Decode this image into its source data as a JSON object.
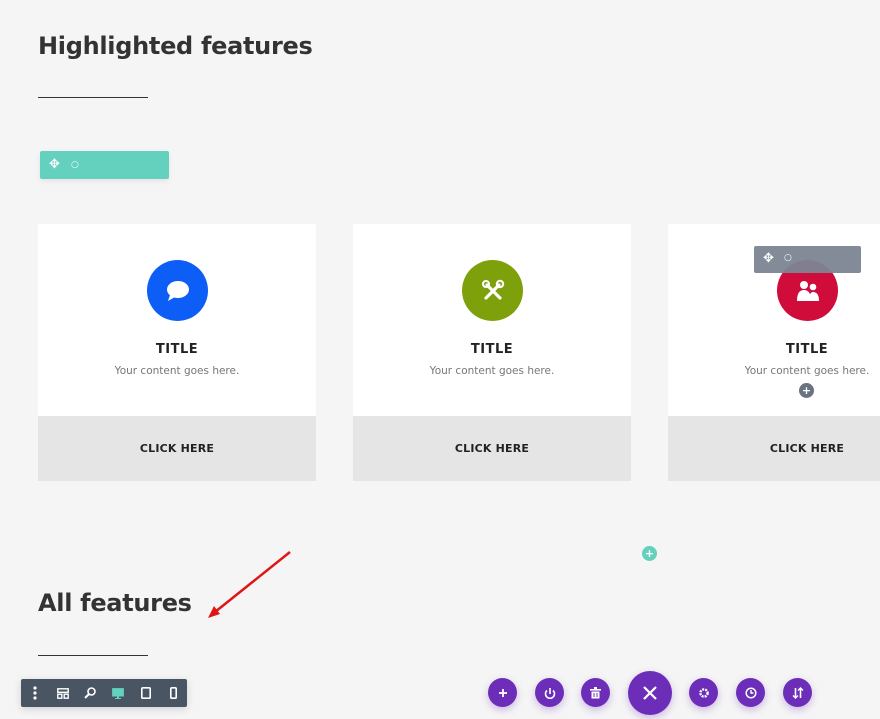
{
  "sections": {
    "highlighted": {
      "heading": "Highlighted features"
    },
    "all": {
      "heading": "All features"
    }
  },
  "cards": [
    {
      "icon": "chat-bubble-icon",
      "color": "#0c5ef6",
      "title": "TITLE",
      "text": "Your content goes here.",
      "button": "CLICK HERE"
    },
    {
      "icon": "tools-icon",
      "color": "#7ea00a",
      "title": "TITLE",
      "text": "Your content goes here.",
      "button": "CLICK HERE"
    },
    {
      "icon": "users-icon",
      "color": "#d00c3a",
      "title": "TITLE",
      "text": "Your content goes here.",
      "button": "CLICK HERE"
    }
  ],
  "colors": {
    "row_handle": "#63d1bd",
    "module_handle": "#7d8594",
    "builder_purple": "#6c2eb9",
    "toolbar_bg": "#4a5564",
    "toolbar_active": "#63d1bd"
  },
  "icons": {
    "move": "✥",
    "settings_dot": "○",
    "plus": "+"
  },
  "view_toolbar": [
    "more-options-icon",
    "wireframe-view-icon",
    "zoom-icon",
    "desktop-view-icon",
    "tablet-view-icon",
    "phone-view-icon"
  ],
  "page_actions": [
    "add-icon",
    "portability-icon",
    "clear-layout-icon",
    "close-icon",
    "page-settings-icon",
    "history-icon",
    "sort-icon"
  ],
  "active_view": "desktop"
}
